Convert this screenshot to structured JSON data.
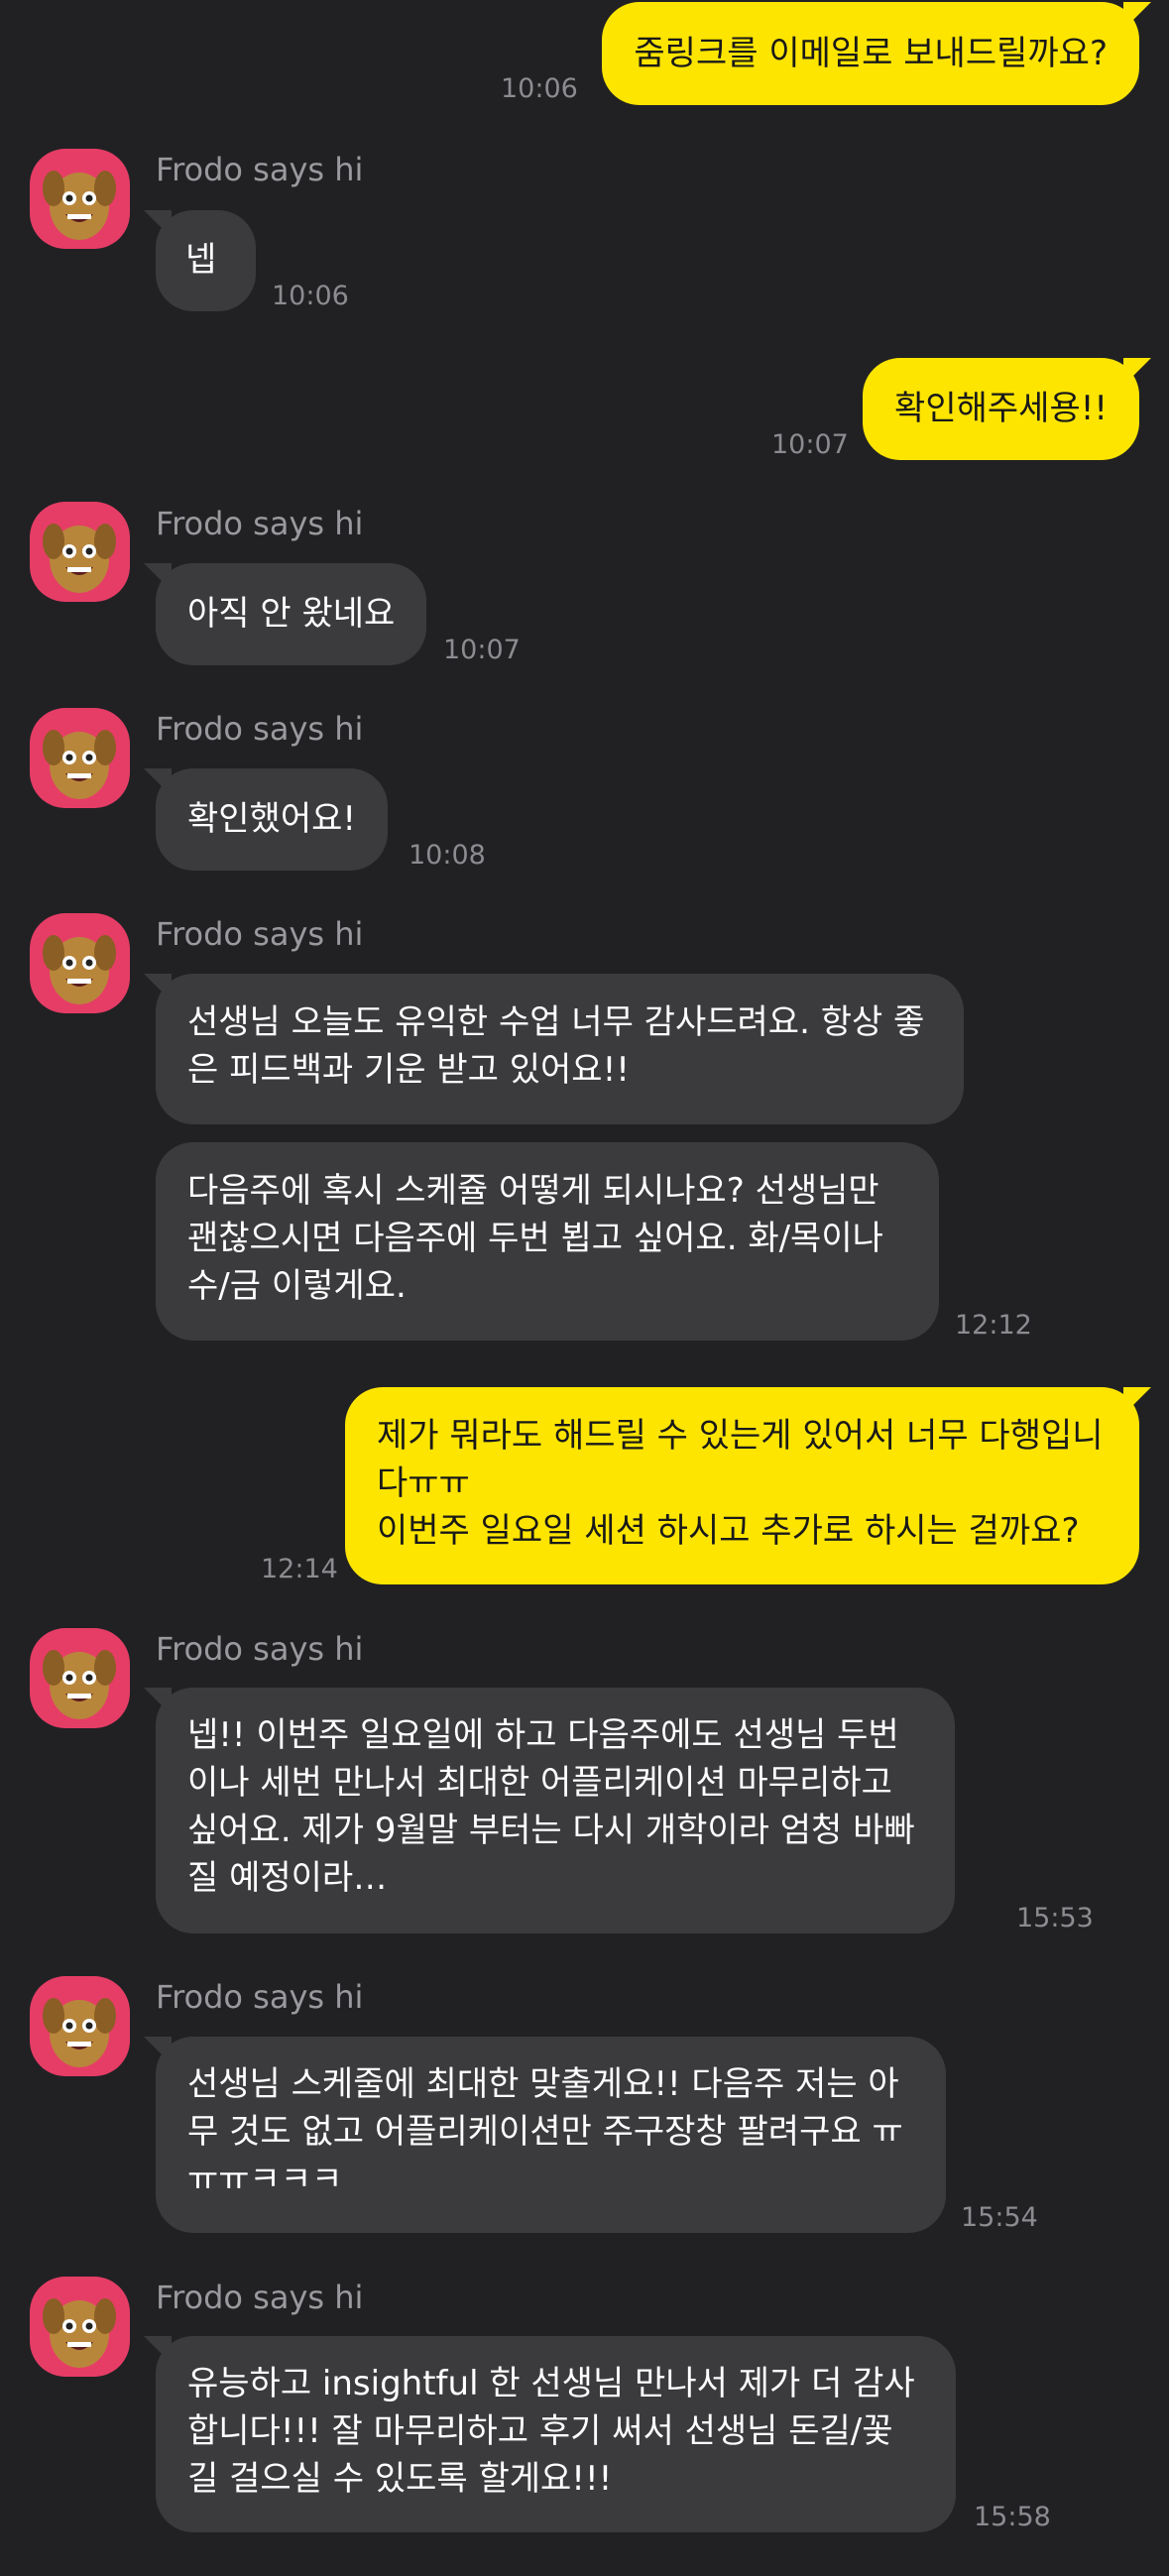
{
  "colors": {
    "background": "#212124",
    "my_bubble": "#fee500",
    "other_bubble": "#3b3b3e",
    "avatar_bg": "#e63d66"
  },
  "contact": {
    "name": "Frodo says hi",
    "avatar_icon": "frodo-character-icon"
  },
  "messages": [
    {
      "text": "줌링크를 이메일로 보내드릴까요?",
      "time": "10:06"
    },
    {
      "text": "넵",
      "time": "10:06"
    },
    {
      "text": "확인해주세용!!",
      "time": "10:07"
    },
    {
      "text": "아직 안 왔네요",
      "time": "10:07"
    },
    {
      "text": "확인했어요!",
      "time": "10:08"
    },
    {
      "text": "선생님 오늘도 유익한 수업 너무 감사드려요. 항상 좋\n은 피드백과 기운 받고 있어요!!"
    },
    {
      "text": "다음주에 혹시 스케쥴 어떻게 되시나요? 선생님만\n괜찮으시면 다음주에 두번 뵙고 싶어요. 화/목이나\n수/금 이렇게요.",
      "time": "12:12"
    },
    {
      "text": "제가 뭐라도 해드릴 수 있는게 있어서 너무 다행입니\n다ㅠㅠ\n이번주 일요일 세션 하시고 추가로 하시는 걸까요?",
      "time": "12:14"
    },
    {
      "text": "넵!! 이번주 일요일에 하고 다음주에도 선생님 두번\n이나 세번 만나서 최대한 어플리케이션 마무리하고\n싶어요. 제가 9월말 부터는 다시 개학이라 엄청 바빠\n질 예정이라…",
      "time": "15:53"
    },
    {
      "text": "선생님 스케줄에 최대한 맞출게요!! 다음주 저는 아\n무 것도 없고 어플리케이션만 주구장창 팔려구요 ㅠ\nㅠㅠㅋㅋㅋ",
      "time": "15:54"
    },
    {
      "text": "유능하고 insightful 한 선생님 만나서 제가 더 감사\n합니다!!! 잘 마무리하고 후기 써서 선생님 돈길/꽃\n길 걸으실 수 있도록 할게요!!!",
      "time": "15:58"
    }
  ]
}
